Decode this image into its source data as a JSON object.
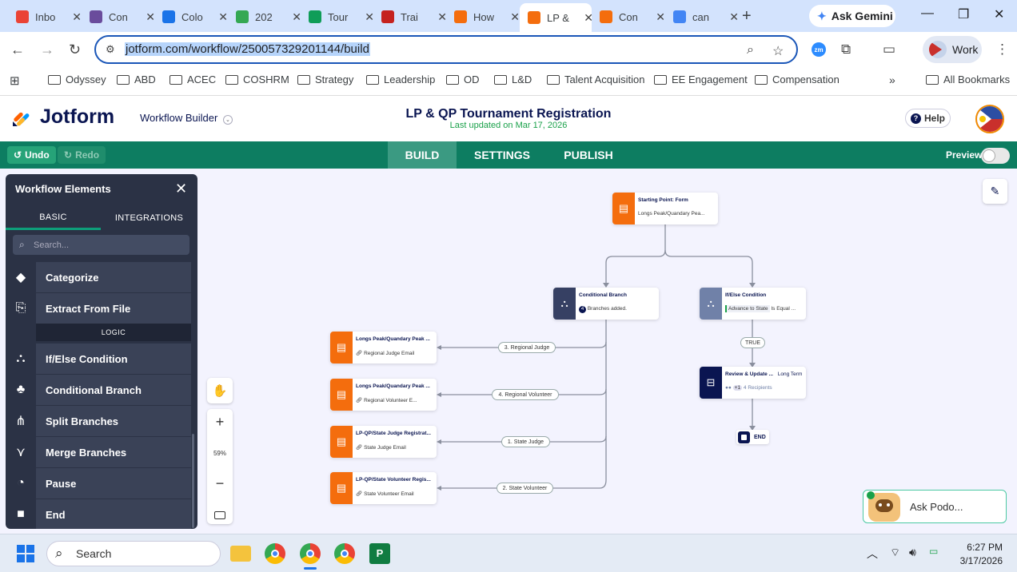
{
  "browser": {
    "tabs": [
      {
        "label": "Inbo",
        "icon": "gmail-icon",
        "color": "#ea4335"
      },
      {
        "label": "Con",
        "icon": "globe-icon",
        "color": "#6a4c9c"
      },
      {
        "label": "Colo",
        "icon": "calendar-icon",
        "color": "#1a73e8"
      },
      {
        "label": "202",
        "icon": "drive-icon",
        "color": "#34a853"
      },
      {
        "label": "Tour",
        "icon": "sheets-icon",
        "color": "#0f9d58"
      },
      {
        "label": "Trai",
        "icon": "mail-icon",
        "color": "#c5221f"
      },
      {
        "label": "How",
        "icon": "jotform-icon",
        "color": "#f46d0d"
      },
      {
        "label": "LP &",
        "icon": "jotform-icon",
        "color": "#f46d0d"
      },
      {
        "label": "Con",
        "icon": "jotform-icon",
        "color": "#f46d0d"
      },
      {
        "label": "can",
        "icon": "google-icon",
        "color": "#4285f4"
      }
    ],
    "active_tab_index": 7,
    "gemini_label": "Ask Gemini",
    "url": "jotform.com/workflow/250057329201144/build",
    "profile_label": "Work",
    "bookmarks": [
      "Odyssey",
      "ABD",
      "ACEC",
      "COSHRM",
      "Strategy",
      "Leadership",
      "OD",
      "L&D",
      "Talent Acquisition",
      "EE Engagement",
      "Compensation"
    ],
    "all_bookmarks_label": "All Bookmarks"
  },
  "jotform": {
    "logo_text": "Jotform",
    "builder_label": "Workflow Builder",
    "form_title": "LP & QP Tournament Registration",
    "last_updated": "Last updated on Mar 17, 2026",
    "help_label": "Help",
    "undo_label": "Undo",
    "redo_label": "Redo",
    "nav_tabs": [
      "BUILD",
      "SETTINGS",
      "PUBLISH"
    ],
    "active_nav": "BUILD",
    "preview_label": "Preview",
    "preview_on": false,
    "accent_color": "#0d7d61"
  },
  "panel": {
    "title": "Workflow Elements",
    "tabs": [
      "BASIC",
      "INTEGRATIONS"
    ],
    "active_tab": "BASIC",
    "search_placeholder": "Search...",
    "items_top": [
      {
        "label": "Categorize",
        "icon": "categorize-icon"
      },
      {
        "label": "Extract From File",
        "icon": "extract-file-icon"
      }
    ],
    "section_label": "LOGIC",
    "items_logic": [
      {
        "label": "If/Else Condition",
        "icon": "if-else-icon"
      },
      {
        "label": "Conditional Branch",
        "icon": "conditional-branch-icon"
      },
      {
        "label": "Split Branches",
        "icon": "split-branches-icon"
      },
      {
        "label": "Merge Branches",
        "icon": "merge-branches-icon"
      },
      {
        "label": "Pause",
        "icon": "stopwatch-icon"
      },
      {
        "label": "End",
        "icon": "end-square-icon"
      }
    ]
  },
  "zoom": {
    "level": "59%"
  },
  "workflow": {
    "start": {
      "title": "Starting Point: Form",
      "subtitle": "Longs Peak/Quandary Pea..."
    },
    "conditional_branch": {
      "title": "Conditional Branch",
      "subtitle": "Branches added.",
      "count": "4"
    },
    "if_else": {
      "title": "If/Else Condition",
      "tag": "Advance to State",
      "condition": "Is Equal ..."
    },
    "true_label": "TRUE",
    "review": {
      "title": "Review & Update ...",
      "tag": "Long Term",
      "recipients": "4 Recipients",
      "extra": "+1"
    },
    "end_label": "END",
    "email_nodes": [
      {
        "title": "Longs Peak/Quandary Peak ...",
        "subtitle": "Regional Judge Email",
        "branch": "3. Regional Judge"
      },
      {
        "title": "Longs Peak/Quandary Peak ...",
        "subtitle": "Regional Volunteer E...",
        "branch": "4. Regional Volunteer"
      },
      {
        "title": "LP-QP/State Judge Registrat...",
        "subtitle": "State Judge Email",
        "branch": "1. State Judge"
      },
      {
        "title": "LP-QP/State Volunteer Regis...",
        "subtitle": "State Volunteer Email",
        "branch": "2. State Volunteer"
      }
    ],
    "podo_label": "Ask Podo..."
  },
  "taskbar": {
    "search_label": "Search",
    "time": "6:27 PM",
    "date": "3/17/2026"
  }
}
